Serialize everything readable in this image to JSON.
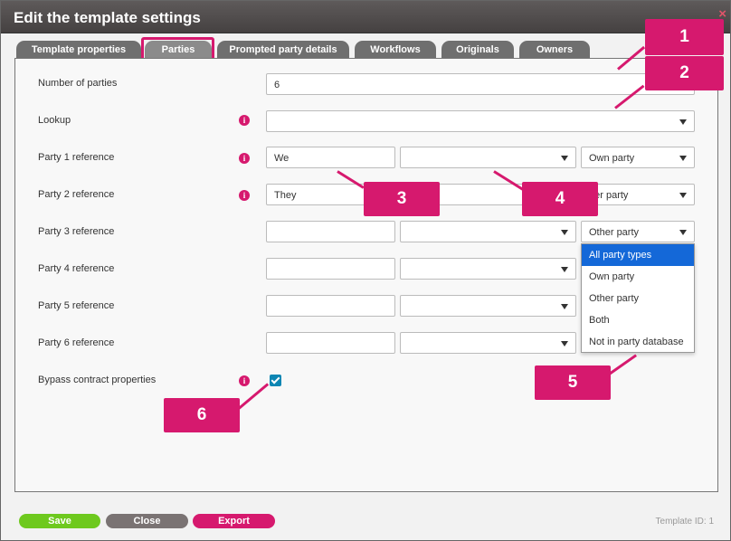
{
  "dialog": {
    "title": "Edit the template settings",
    "close_glyph": "×"
  },
  "tabs": [
    {
      "label": "Template properties"
    },
    {
      "label": "Parties",
      "active": true
    },
    {
      "label": "Prompted party details"
    },
    {
      "label": "Workflows"
    },
    {
      "label": "Originals"
    },
    {
      "label": "Owners"
    }
  ],
  "form": {
    "number_of_parties": {
      "label": "Number of parties",
      "value": "6"
    },
    "lookup": {
      "label": "Lookup",
      "value": ""
    },
    "parties": [
      {
        "label": "Party 1 reference",
        "name": "We",
        "type": "",
        "role": "Own party"
      },
      {
        "label": "Party 2 reference",
        "name": "They",
        "type": "",
        "role": "her party"
      },
      {
        "label": "Party 3 reference",
        "name": "",
        "type": "",
        "role": "Other party"
      },
      {
        "label": "Party 4 reference",
        "name": "",
        "type": "",
        "role": ""
      },
      {
        "label": "Party 5 reference",
        "name": "",
        "type": "",
        "role": ""
      },
      {
        "label": "Party 6 reference",
        "name": "",
        "type": "",
        "role": ""
      }
    ],
    "bypass": {
      "label": "Bypass contract properties",
      "checked": true
    },
    "info_glyph": "i"
  },
  "dropdown_options": [
    {
      "label": "All party types",
      "highlighted": true
    },
    {
      "label": "Own party"
    },
    {
      "label": "Other party"
    },
    {
      "label": "Both"
    },
    {
      "label": "Not in party database"
    }
  ],
  "footer": {
    "save": "Save",
    "close": "Close",
    "export": "Export",
    "template_id_label": "Template ID:",
    "template_id_value": "1"
  },
  "callouts": [
    "1",
    "2",
    "3",
    "4",
    "5",
    "6"
  ],
  "colors": {
    "accent": "#d6196e",
    "save": "#6ec91e",
    "close": "#7a7373",
    "export": "#d6196e",
    "highlight": "#1468d8"
  }
}
